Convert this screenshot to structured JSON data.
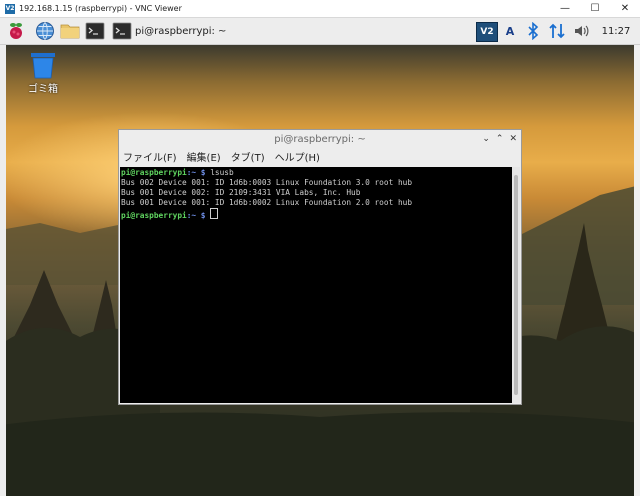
{
  "window": {
    "title": "192.168.1.15 (raspberrypi) - VNC Viewer",
    "logo_text": "V2",
    "minimize": "—",
    "maximize": "☐",
    "close": "✕"
  },
  "panel": {
    "icons": [
      "raspberry-menu-icon",
      "web-browser-icon",
      "file-manager-icon",
      "terminal-icon"
    ],
    "task_label": "pi@raspberrypi: ~",
    "tray": {
      "vnc": "V2",
      "input_method": "A",
      "bluetooth": "bluetooth-icon",
      "network": "network-arrows-icon",
      "volume": "volume-icon",
      "clock": "11:27"
    }
  },
  "desktop": {
    "trash_label": "ゴミ箱"
  },
  "terminal": {
    "title": "pi@raspberrypi: ~",
    "menu": [
      "ファイル(F)",
      "編集(E)",
      "タブ(T)",
      "ヘルプ(H)"
    ],
    "prompt_user": "pi@raspberrypi",
    "prompt_sep": ":",
    "prompt_path": "~ $",
    "command": " lsusb",
    "output": [
      "Bus 002 Device 001: ID 1d6b:0003 Linux Foundation 3.0 root hub",
      "Bus 001 Device 002: ID 2109:3431 VIA Labs, Inc. Hub",
      "Bus 001 Device 001: ID 1d6b:0002 Linux Foundation 2.0 root hub"
    ]
  },
  "colors": {
    "prompt_user": "#5fd35f",
    "prompt_path": "#6f8fe8",
    "terminal_bg": "#000000"
  }
}
